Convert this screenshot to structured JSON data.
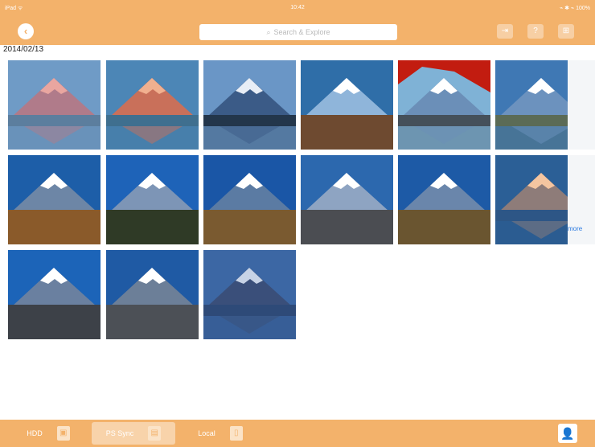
{
  "status_bar": {
    "left": "iPad ᯤ",
    "time": "10:42",
    "right": "⌁ ✱ ⌁ 100%"
  },
  "topbar": {
    "search_placeholder": "Search & Explore"
  },
  "date_label": "2014/02/13",
  "thumbnails": [
    {
      "name": "mt-fuji-1"
    },
    {
      "name": "mt-fuji-2"
    },
    {
      "name": "mt-fuji-3"
    },
    {
      "name": "mt-fuji-4"
    },
    {
      "name": "mt-fuji-5"
    },
    {
      "name": "mt-fuji-6"
    },
    {
      "name": "mt-fuji-7"
    },
    {
      "name": "mt-fuji-8"
    },
    {
      "name": "mt-fuji-9"
    },
    {
      "name": "mt-fuji-10"
    },
    {
      "name": "mt-fuji-11"
    },
    {
      "name": "mt-fuji-12"
    },
    {
      "name": "mt-fuji-13"
    },
    {
      "name": "mt-fuji-14"
    },
    {
      "name": "mt-fuji-15"
    }
  ],
  "more_link": "more",
  "bottom_tabs": [
    {
      "label": "HDD"
    },
    {
      "label": "PS Sync"
    },
    {
      "label": "Local"
    }
  ],
  "colors": {
    "accent": "#f3b26b"
  }
}
